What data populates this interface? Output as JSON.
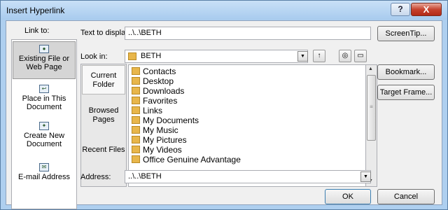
{
  "window": {
    "title": "Insert Hyperlink",
    "help_glyph": "?",
    "close_glyph": "X"
  },
  "link_to": {
    "label": "Link to:",
    "items": [
      {
        "label_line1": "Existing File or",
        "label_line2": "Web Page",
        "icon": "web-page-icon"
      },
      {
        "label_line1": "Place in This",
        "label_line2": "Document",
        "icon": "place-in-document-icon"
      },
      {
        "label_line1": "Create New",
        "label_line2": "Document",
        "icon": "new-document-icon"
      },
      {
        "label_line1": "E-mail Address",
        "label_line2": "",
        "icon": "email-icon"
      }
    ]
  },
  "text_to_display": {
    "label": "Text to display:",
    "value": "..\\..\\BETH"
  },
  "screentip_label": "ScreenTip...",
  "look_in": {
    "label": "Look in:",
    "value": "BETH",
    "icon": "folder-icon"
  },
  "nav": [
    {
      "line1": "Current",
      "line2": "Folder"
    },
    {
      "line1": "Browsed",
      "line2": "Pages"
    },
    {
      "line1": "Recent Files",
      "line2": ""
    }
  ],
  "files": [
    "Contacts",
    "Desktop",
    "Downloads",
    "Favorites",
    "Links",
    "My Documents",
    "My Music",
    "My Pictures",
    "My Videos",
    "Office Genuine Advantage"
  ],
  "bookmark_label": "Bookmark...",
  "target_frame_label": "Target Frame...",
  "address": {
    "label": "Address:",
    "value": "..\\..\\BETH"
  },
  "ok_label": "OK",
  "cancel_label": "Cancel",
  "colors": {
    "title_bg": "#aecfef",
    "close_red": "#c6432e",
    "client_bg": "#f0f0f0"
  }
}
